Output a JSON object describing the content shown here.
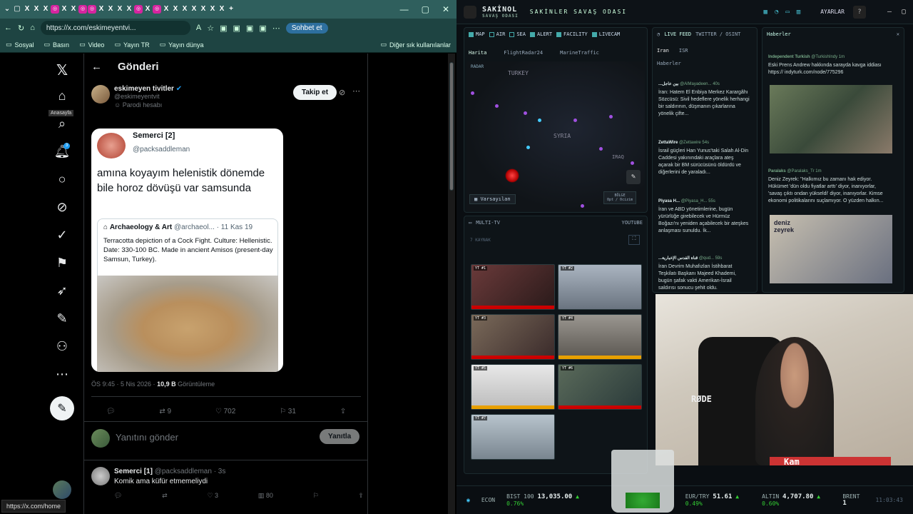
{
  "browser": {
    "url": "https://x.com/eskimeyentvi...",
    "chat_button": "Sohbet et",
    "bookmarks": [
      "Sosyal",
      "Basın",
      "Video",
      "Yayın TR",
      "Yayın dünya"
    ],
    "other_bookmarks": "Diğer sık kullanılanlar"
  },
  "x": {
    "tooltip": "Anasayfa",
    "notification_count": "3",
    "page_title": "Gönderi",
    "author_name": "eskimeyen tivitler",
    "author_handle": "@eskimeyentvit",
    "author_badge": "Parodi hesabı",
    "follow_label": "Takip et",
    "quoted_name": "Semerci [2]",
    "quoted_handle": "@packsaddleman",
    "quoted_text": "amına koyayım helenistik dönemde bile horoz dövüşü var samsunda",
    "inner_name": "Archaeology & Art",
    "inner_handle": "@archaeol...",
    "inner_date": "· 11 Kas 19",
    "inner_text": "Terracotta depiction of a Cock Fight. Culture: Hellenistic. Date: 330-100 BC. Made in ancient Amisos (present-day Samsun, Turkey).",
    "timestamp": "ÖS 9:45 · 5 Nis 2026 ·",
    "views": "10,9 B",
    "views_label": "Görüntüleme",
    "retweets": "9",
    "likes": "702",
    "bookmarks": "31",
    "reply_placeholder": "Yanıtını gönder",
    "reply_button": "Yanıtla",
    "reply_name": "Semerci",
    "reply_rank": "[1]",
    "reply_handle": "@packsaddleman · 3s",
    "reply_text": "Komik ama küfür etmemeliydi",
    "reply_likes": "3",
    "reply_views": "80",
    "status_url": "https://x.com/home"
  },
  "dashboard": {
    "brand": "SAKİNOL",
    "brand_sub": "SAVAŞ ODASI",
    "title": "SAKİNLER SAVAŞ ODASI",
    "settings": "AYARLAR",
    "map_tabs": [
      "MAP",
      "AIR",
      "SEA",
      "ALERT",
      "FACILITY",
      "LIVECAM"
    ],
    "map_views": [
      "Harita",
      "FlightRadar24",
      "MarineTraffic"
    ],
    "map_labels": [
      "TURKEY",
      "SYRIA",
      "IRAQ"
    ],
    "map_preset": "Varsayılan",
    "map_region": "BÖLGE",
    "map_region_val": "0pt / 0cizim",
    "radar_label": "RADAR",
    "multitv_title": "MULTI-TV",
    "multitv_source": "YOUTUBE",
    "multitv_count": "7 KAYNAK",
    "tv_labels": [
      "YT #1",
      "YT #2",
      "YT #3",
      "YT #4",
      "YT #5",
      "YT #6",
      "YT #7"
    ],
    "live_feed_title": "LIVE FEED",
    "live_feed_sub": "TWITTER / OSINT",
    "feed_tabs": [
      "Iran",
      "ISR",
      "Haberler"
    ],
    "feed": [
      {
        "source": "...بين عاجل",
        "handle": "@AlMayadeen...",
        "time": "40s",
        "text": "İran: Hatem El Enbiya Merkez Karargâhı Sözcüsü: Sivil hedeflere yönelik herhangi bir saldırının, düşmanın çıkarlarına yönelik çifte..."
      },
      {
        "source": "ZettaWire",
        "handle": "@Zettawire",
        "time": "54s",
        "text": "İsrail güçleri Han Yunus'taki Salah Al-Din Caddesi yakınındaki araçlara ateş açarak bir BM sürücüsünü öldürdü ve diğerlerini de yaraladı..."
      },
      {
        "source": "Piyasa H...",
        "handle": "@Piyasa_H...",
        "time": "55s",
        "text": "İran ve ABD yönetimlerine, bugün yürürlüğe girebilecek ve Hürmüz Boğazı'nı yeniden açabilecek bir ateşkes anlaşması sunuldu. İk..."
      },
      {
        "source": "...قناة القدس الإخبارية",
        "handle": "@qud...",
        "time": "59s",
        "text": "İran Devrim Muhafızları İstihbarat Teşkilatı Başkanı Majeed Khademi, bugün şafak vakti Amerikan-İsrail saldırısı sonucu şehit oldu."
      }
    ],
    "news_title": "Haberler",
    "news": [
      {
        "source": "Independent Turkish",
        "handle": "@TurkishIndy",
        "time": "1m",
        "text": "Eski Prens Andrew hakkında sarayda kavga iddiası https:// indyturk.com/node/775296"
      },
      {
        "source": "Paralaks",
        "handle": "@Paralaks_Tr",
        "time": "1m",
        "text": "Deniz Zeyrek: \"Halkımız bu zamanı hak ediyor. Hükümet 'dün oldu fiyatlar arttı' diyor, inanıyorlar, 'savaş çıktı ondan yükseldi' diyor, inanıyorlar. Kimse ekonomi politikalarını suçlamıyor. O yüzden halkın..."
      }
    ],
    "news_img_text": "deniz zeyrek",
    "ticker_label": "ECON",
    "ticker": [
      {
        "name": "BIST 100",
        "value": "13,035.00",
        "change": "▲ 0.76%"
      },
      {
        "name": "EUR/TRY",
        "value": "51.61",
        "change": "▲ 0.49%"
      },
      {
        "name": "ALTIN",
        "value": "4,707.80",
        "change": "▲ 0.60%"
      },
      {
        "name": "BRENT",
        "value": "1",
        "change": ""
      }
    ],
    "clock": "11:03:43",
    "webcam_mic": "RØDE",
    "webcam_caption": "Kam"
  }
}
